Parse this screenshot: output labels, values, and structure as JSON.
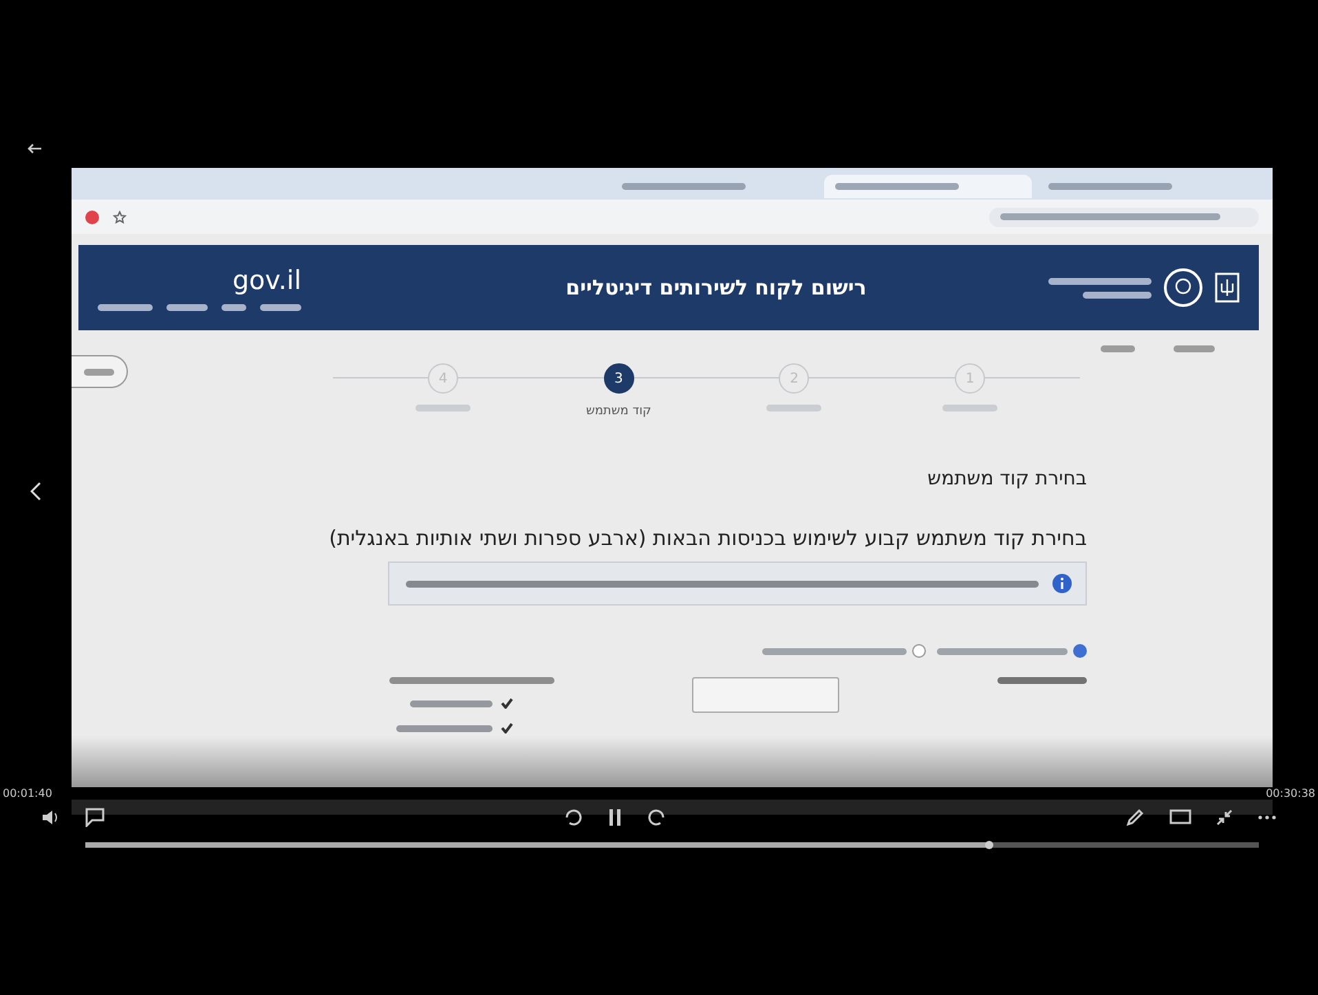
{
  "browser": {
    "tabs": [
      {
        "selected": false
      },
      {
        "selected": true
      },
      {
        "selected": false
      }
    ]
  },
  "header": {
    "logo": "gov.il",
    "title": "רישום לקוח לשירותים דיגיטליים"
  },
  "stepper": {
    "steps": [
      {
        "number": "1",
        "selected": false
      },
      {
        "number": "2",
        "selected": false
      },
      {
        "number": "3",
        "label": "קוד משתמש",
        "selected": true
      },
      {
        "number": "4",
        "selected": false
      }
    ]
  },
  "section_title": "בחירת קוד משתמש",
  "heading": "בחירת קוד משתמש קבוע לשימוש בכניסות הבאות (ארבע ספרות ושתי אותיות באנגלית)",
  "radios": [
    {
      "selected": true
    },
    {
      "selected": false
    }
  ],
  "checks": [
    {
      "checked": true
    },
    {
      "checked": true
    }
  ],
  "player": {
    "time_elapsed": "00:01:40",
    "time_total": "00:30:38",
    "progress": {
      "level": 0.77
    }
  }
}
